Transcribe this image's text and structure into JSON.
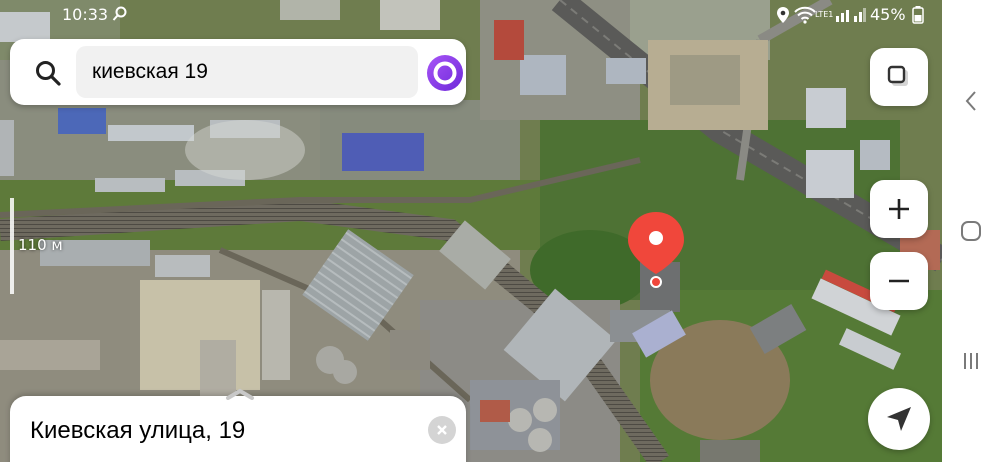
{
  "status_bar": {
    "time": "10:33",
    "network_label": "LTE1",
    "battery_percent": "45%",
    "icons": [
      "search-icon",
      "location-icon",
      "wifi-icon",
      "cellular-signal-icon",
      "battery-icon"
    ]
  },
  "search": {
    "query": "киевская 19",
    "icon": "search-icon",
    "assistant_icon": "alice-assistant-icon",
    "accent_color": "#7c3aed"
  },
  "map": {
    "scale_label": "110 м",
    "marker_color": "#f0473b",
    "buttons": [
      {
        "name": "layers-button",
        "icon": "layers-icon"
      },
      {
        "name": "zoom-in-button",
        "icon": "plus-icon"
      },
      {
        "name": "zoom-out-button",
        "icon": "minus-icon"
      },
      {
        "name": "my-location-button",
        "icon": "navigation-arrow-icon"
      }
    ]
  },
  "place_card": {
    "title": "Киевская улица, 19",
    "close_icon": "close-icon"
  },
  "system_nav": {
    "buttons": [
      "back-icon",
      "home-icon",
      "recents-icon"
    ]
  }
}
